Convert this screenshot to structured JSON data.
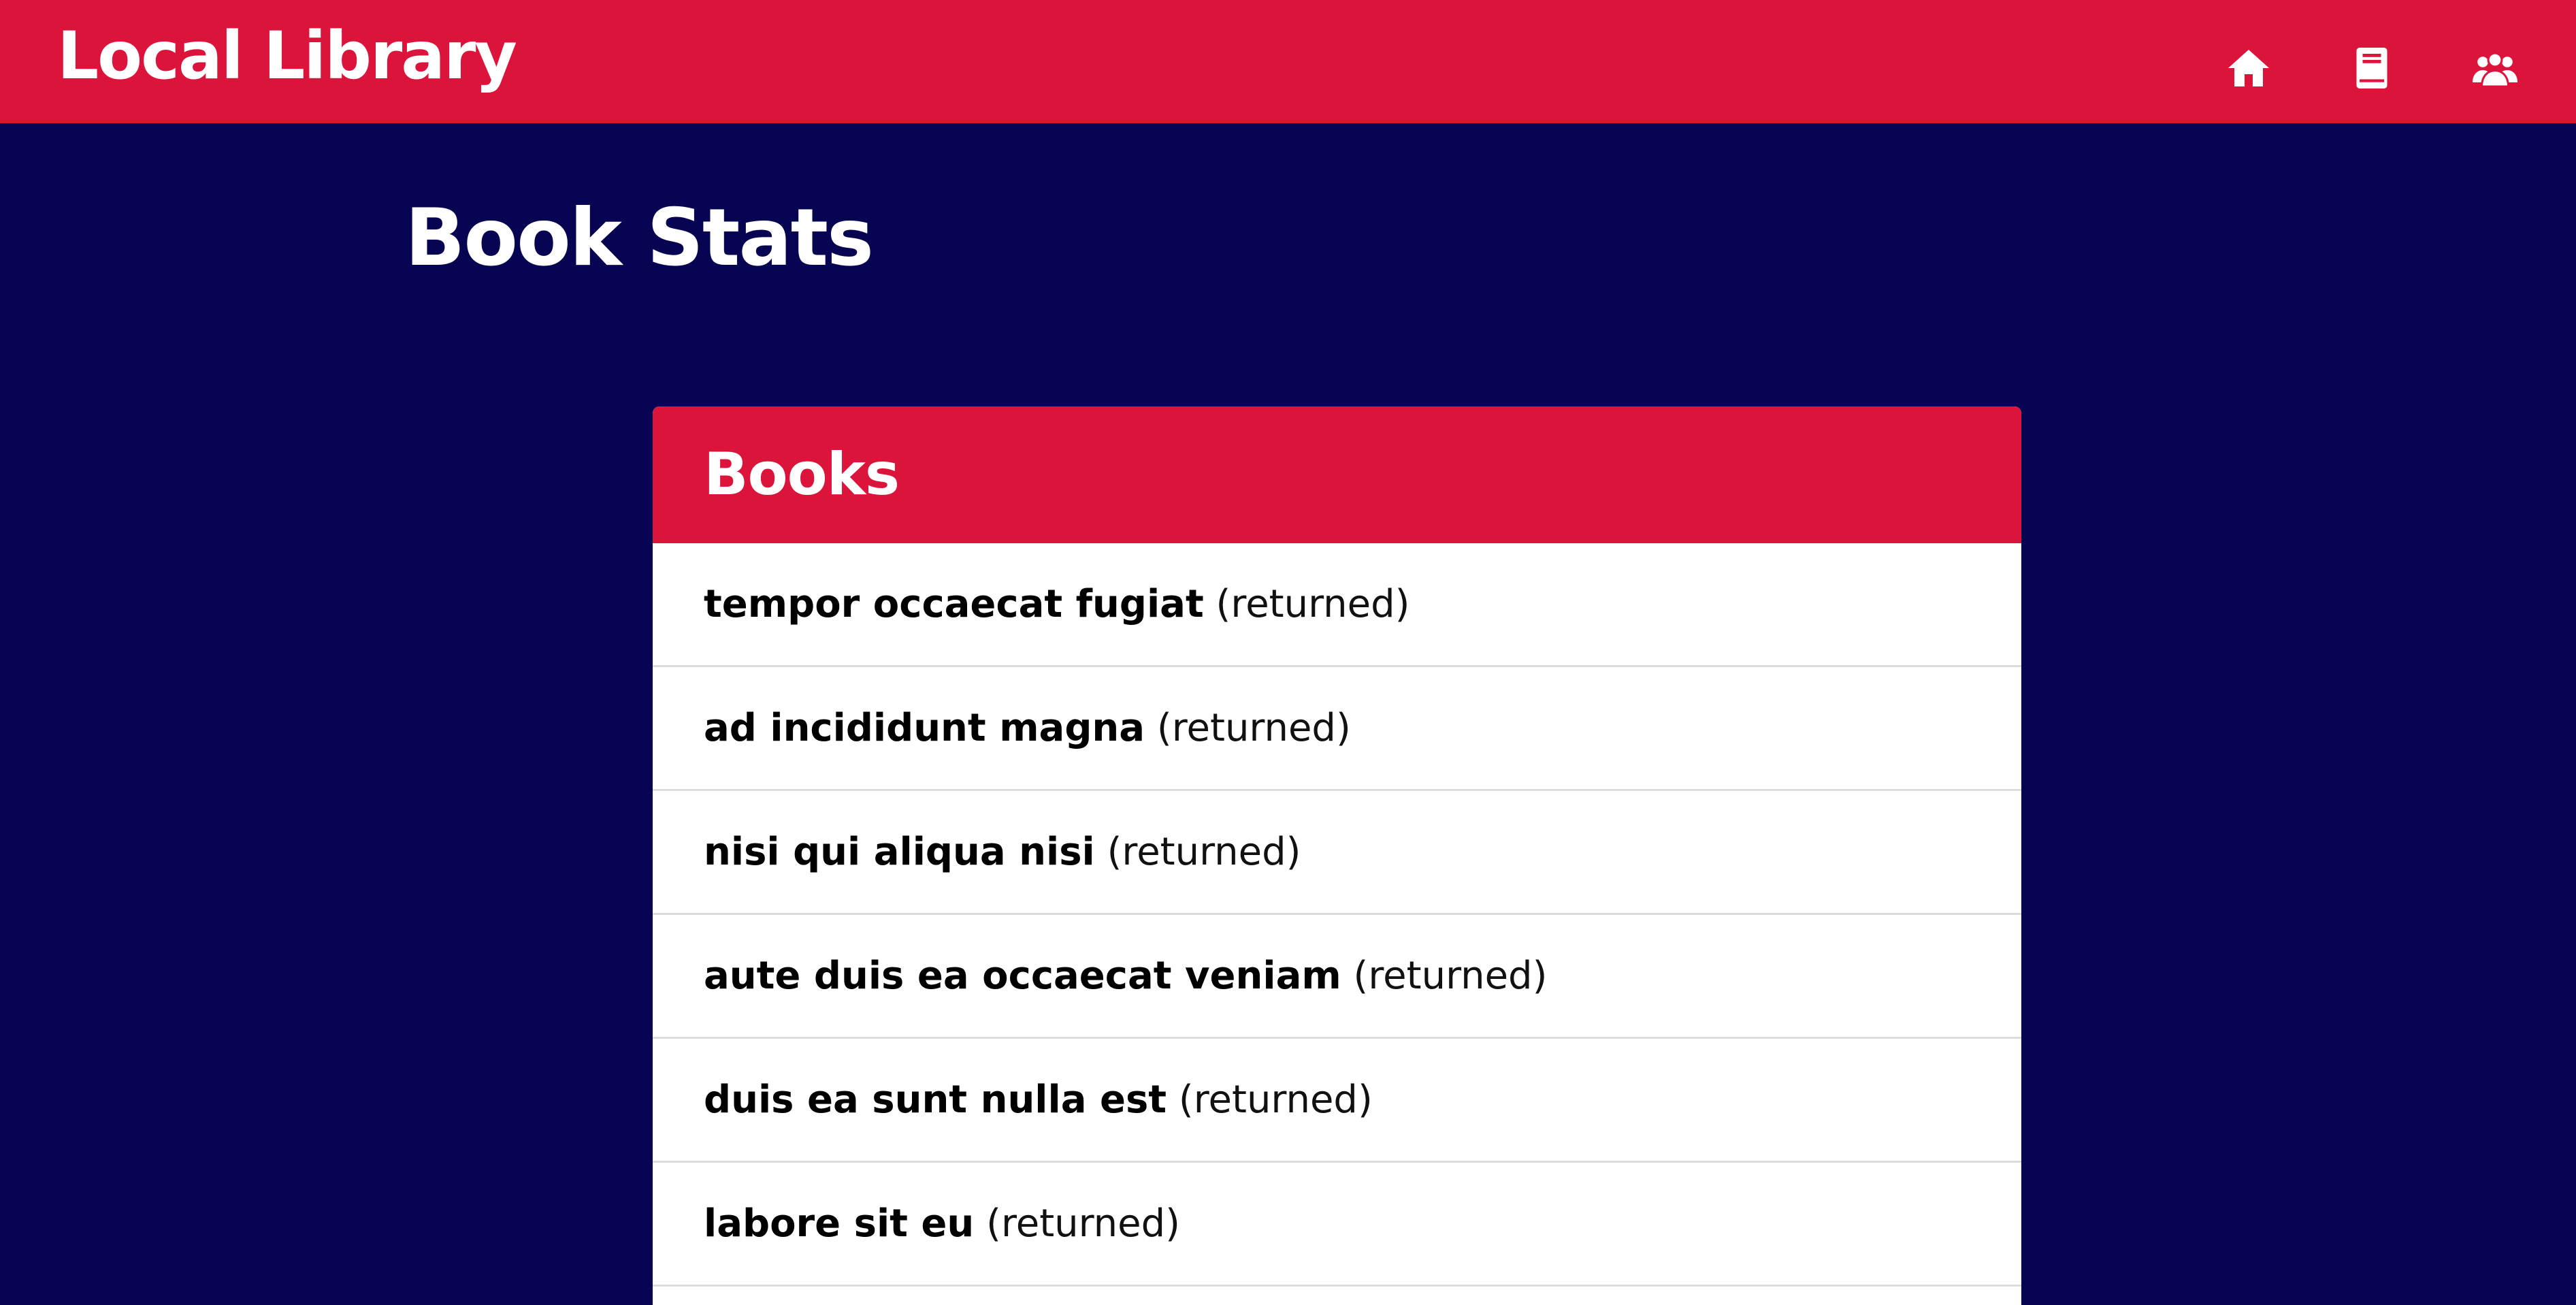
{
  "header": {
    "brand": "Local Library",
    "nav": [
      {
        "icon": "home-icon"
      },
      {
        "icon": "book-icon"
      },
      {
        "icon": "users-icon"
      }
    ]
  },
  "page": {
    "title": "Book Stats"
  },
  "books_card": {
    "heading": "Books",
    "items": [
      {
        "title": "tempor occaecat fugiat",
        "status": "(returned)"
      },
      {
        "title": "ad incididunt magna",
        "status": "(returned)"
      },
      {
        "title": "nisi qui aliqua nisi",
        "status": "(returned)"
      },
      {
        "title": "aute duis ea occaecat veniam",
        "status": "(returned)"
      },
      {
        "title": "duis ea sunt nulla est",
        "status": "(returned)"
      },
      {
        "title": "labore sit eu",
        "status": "(returned)"
      }
    ]
  },
  "colors": {
    "accent": "#dc143c",
    "background": "#070552",
    "card": "#ffffff",
    "divider": "#dcdcdc"
  }
}
